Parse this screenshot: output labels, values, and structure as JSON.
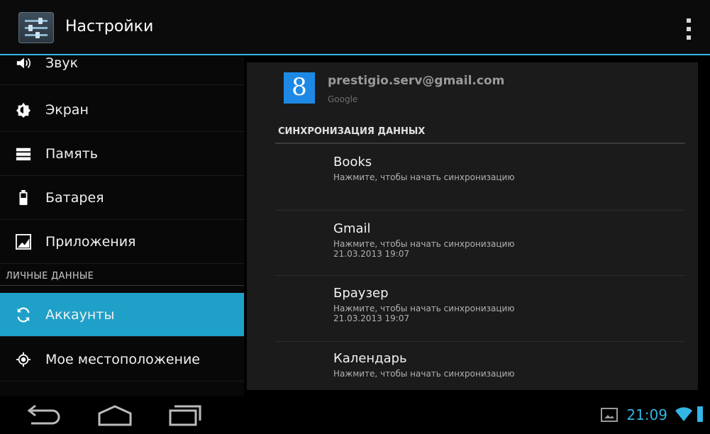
{
  "header": {
    "title": "Настройки"
  },
  "sidebar": {
    "items": [
      {
        "label": "Звук",
        "icon": "speaker-icon",
        "selected": false
      },
      {
        "label": "Экран",
        "icon": "display-icon",
        "selected": false
      },
      {
        "label": "Память",
        "icon": "storage-icon",
        "selected": false
      },
      {
        "label": "Батарея",
        "icon": "battery-icon",
        "selected": false
      },
      {
        "label": "Приложения",
        "icon": "apps-icon",
        "selected": false
      },
      {
        "label": "Аккаунты",
        "icon": "sync-icon",
        "selected": true
      },
      {
        "label": "Мое местоположение",
        "icon": "location-icon",
        "selected": false
      }
    ],
    "section_header": "ЛИЧНЫЕ ДАННЫЕ"
  },
  "account": {
    "email": "prestigio.serv@gmail.com",
    "type": "Google",
    "logo_letter": "8"
  },
  "sync": {
    "header": "СИНХРОНИЗАЦИЯ ДАННЫХ",
    "items": [
      {
        "name": "Books",
        "hint": "Нажмите, чтобы начать синхронизацию",
        "date": ""
      },
      {
        "name": "Gmail",
        "hint": "Нажмите, чтобы начать синхронизацию",
        "date": "21.03.2013 19:07"
      },
      {
        "name": "Браузер",
        "hint": "Нажмите, чтобы начать синхронизацию",
        "date": "21.03.2013 19:07"
      },
      {
        "name": "Календарь",
        "hint": "Нажмите, чтобы начать синхронизацию",
        "date": ""
      }
    ]
  },
  "status": {
    "time": "21:09"
  },
  "colors": {
    "accent": "#33b5e5",
    "selected": "#1fa0c8"
  }
}
